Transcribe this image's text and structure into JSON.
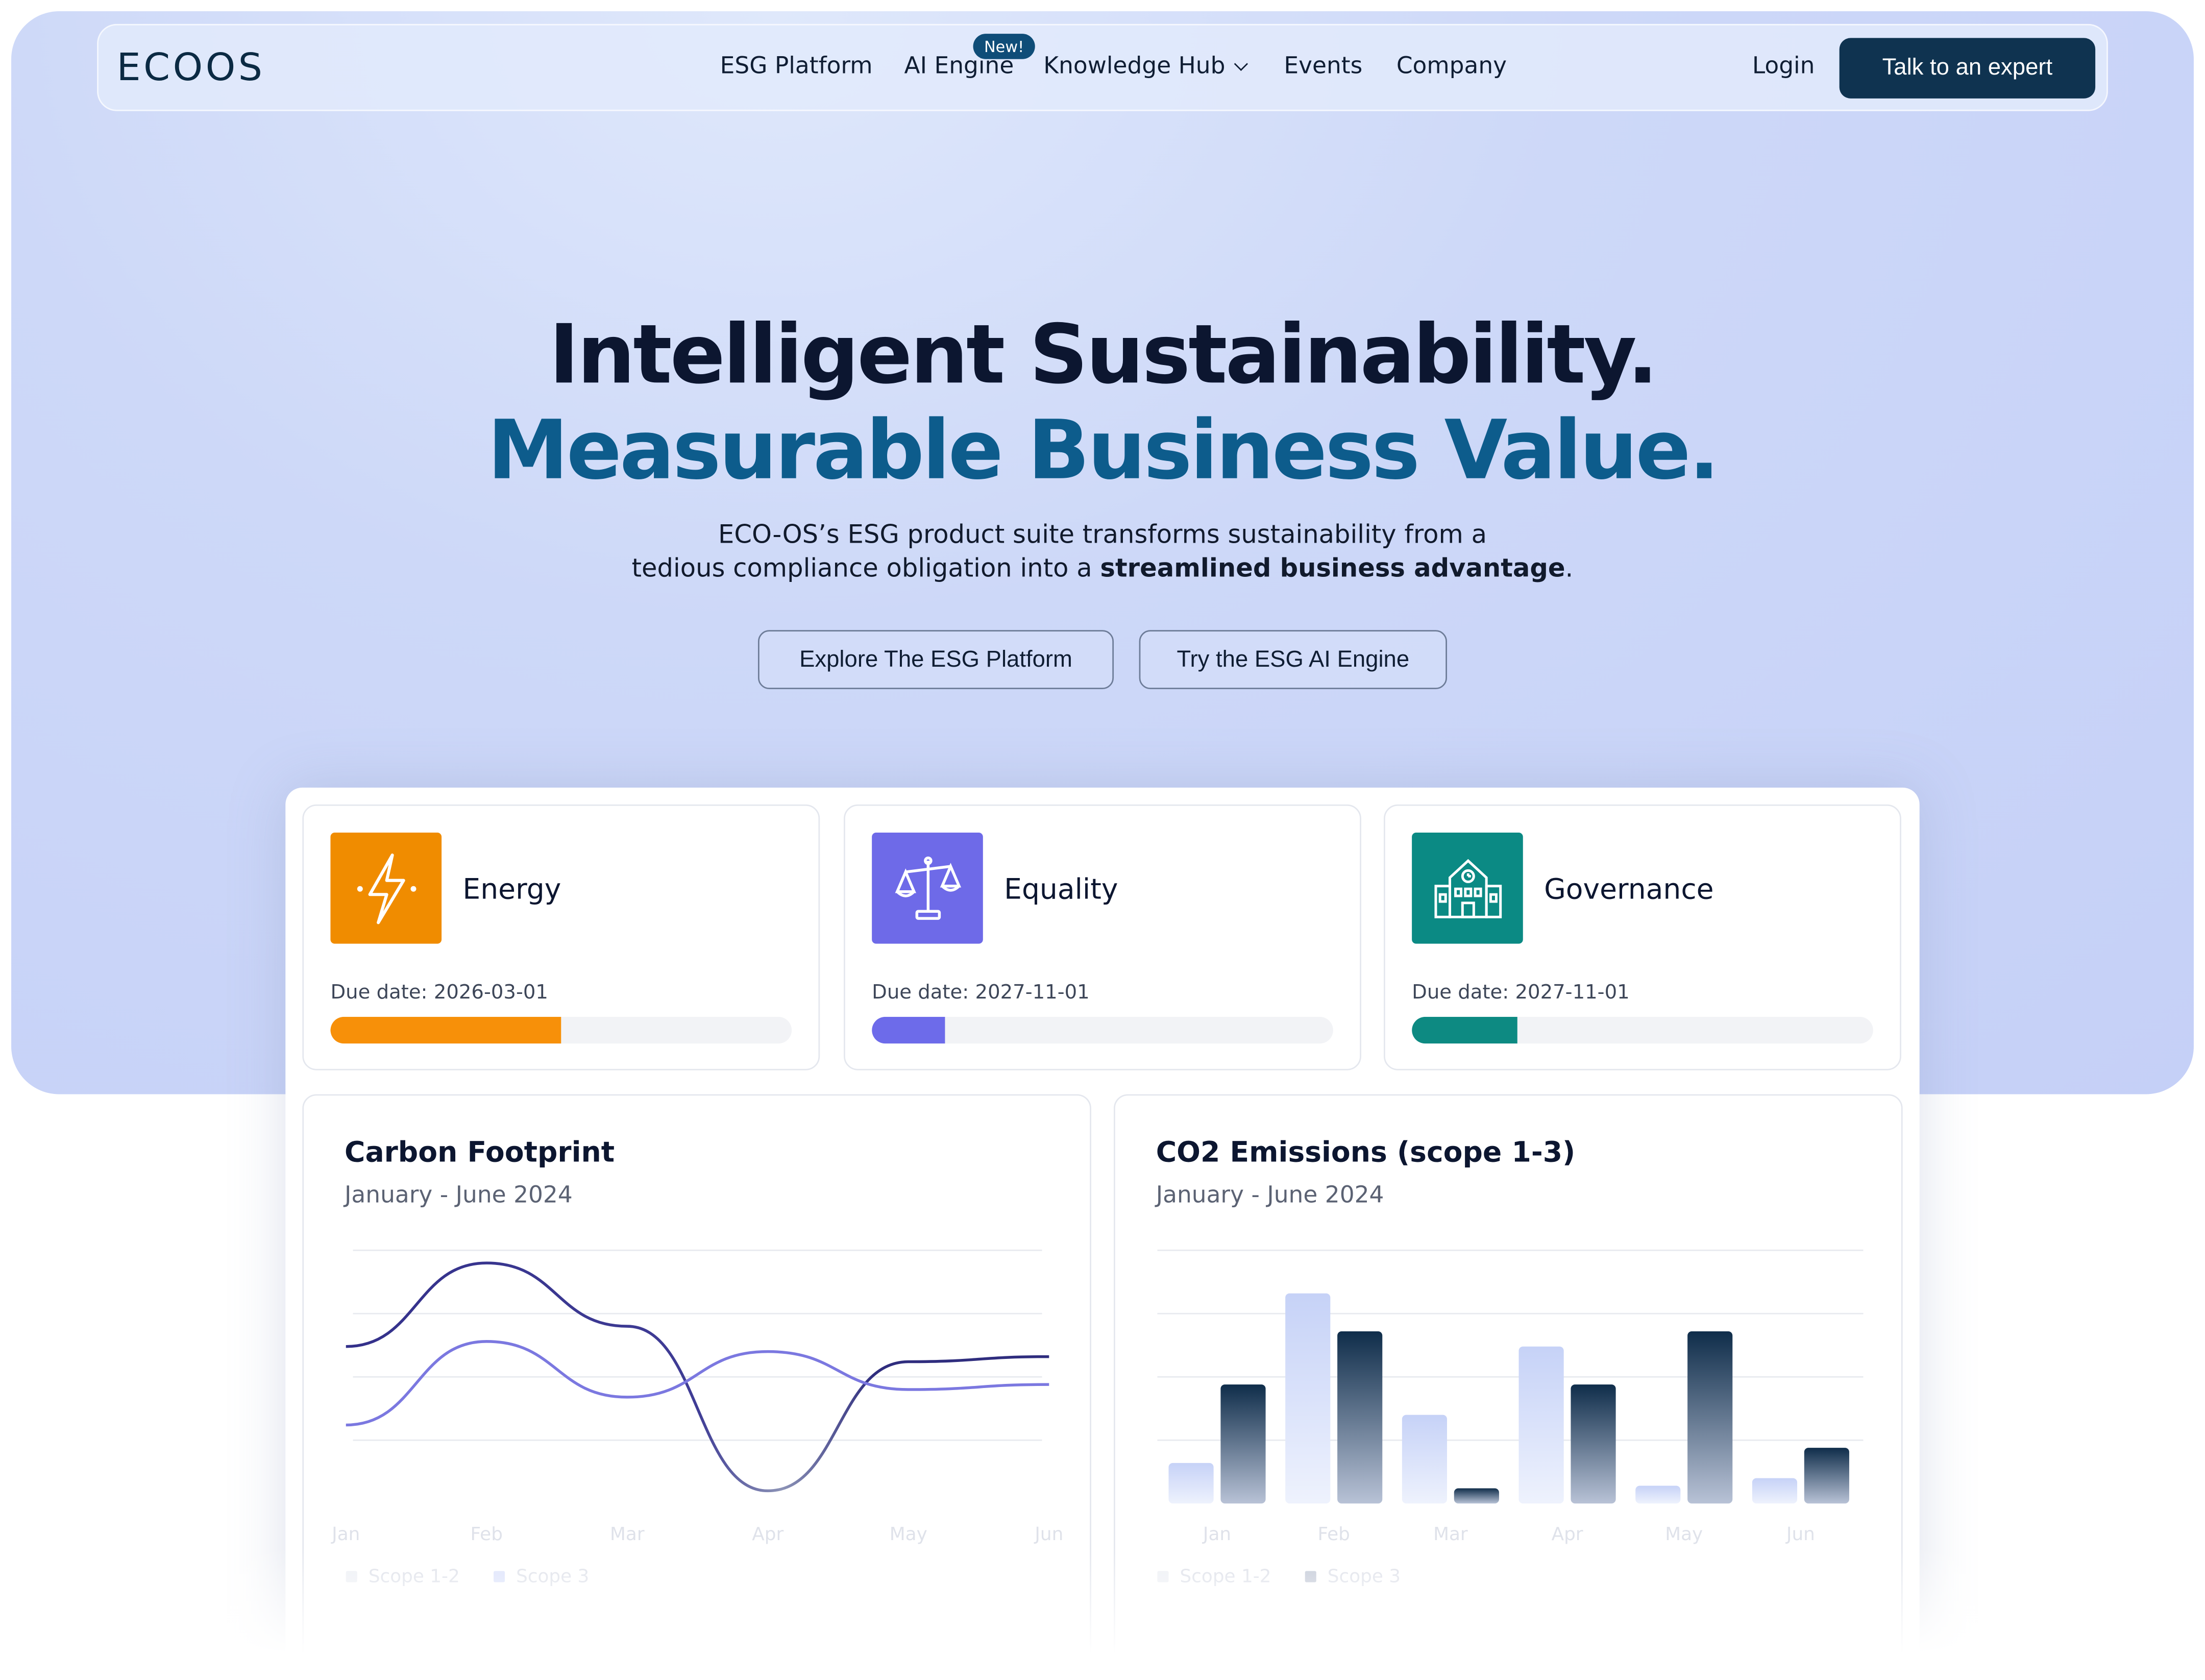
{
  "nav": {
    "logo": "ECOOS",
    "links": [
      "ESG Platform",
      "AI Engine",
      "Knowledge Hub",
      "Events",
      "Company"
    ],
    "new_badge": "New!",
    "login": "Login",
    "cta": "Talk to an expert"
  },
  "hero": {
    "headline_1": "Intelligent Sustainability.",
    "headline_2": "Measurable Business Value.",
    "sub_line_1": "ECO-OS’s ESG product suite transforms sustainability from a",
    "sub_line_2_pre": "tedious compliance obligation into a ",
    "sub_line_2_bold": "streamlined business advantage",
    "sub_line_2_post": ".",
    "btn_primary": "Explore The ESG Platform",
    "btn_secondary": "Try the ESG AI Engine"
  },
  "tiles": [
    {
      "title": "Energy",
      "due": "Due date: 2026-03-01",
      "progress": 0.5,
      "color": "#f79009",
      "icon": "lightning-icon"
    },
    {
      "title": "Equality",
      "due": "Due date: 2027-11-01",
      "progress": 0.16,
      "color": "#6d6bea",
      "icon": "scales-icon"
    },
    {
      "title": "Governance",
      "due": "Due date: 2027-11-01",
      "progress": 0.23,
      "color": "#0d8a82",
      "icon": "building-icon"
    }
  ],
  "chart_data": [
    {
      "type": "line",
      "title": "Carbon Footprint",
      "subtitle": "January - June 2024",
      "categories": [
        "Jan",
        "Feb",
        "Mar",
        "Apr",
        "May",
        "Jun"
      ],
      "series": [
        {
          "name": "Scope 1-2",
          "values": [
            62,
            95,
            70,
            5,
            56,
            58
          ]
        },
        {
          "name": "Scope 3",
          "values": [
            31,
            64,
            42,
            60,
            45,
            47
          ]
        }
      ],
      "ylim": [
        0,
        100
      ],
      "grid": true
    },
    {
      "type": "bar",
      "title": "CO2 Emissions (scope 1-3)",
      "subtitle": "January - June 2024",
      "categories": [
        "Jan",
        "Feb",
        "Mar",
        "Apr",
        "May",
        "Jun"
      ],
      "series": [
        {
          "name": "Scope 1-2",
          "values": [
            16,
            83,
            35,
            62,
            7,
            10
          ]
        },
        {
          "name": "Scope 3",
          "values": [
            47,
            68,
            6,
            47,
            68,
            22
          ]
        }
      ],
      "ylim": [
        0,
        100
      ],
      "grid": true
    }
  ],
  "colors": {
    "accent": "#0f3350",
    "brand_blue": "#0d5c8c",
    "line_dark": "#35338a",
    "line_light": "#7b78e0"
  }
}
